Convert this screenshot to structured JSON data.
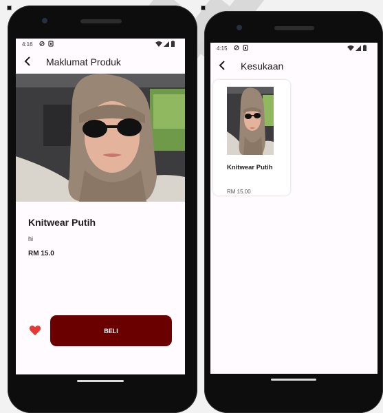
{
  "left_phone": {
    "status": {
      "time": "4:16"
    },
    "appbar": {
      "title": "Maklumat Produk",
      "back_icon": "arrow-back-icon"
    },
    "product": {
      "name": "Knitwear Putih",
      "description": "hi",
      "price": "RM 15.0"
    },
    "actions": {
      "favorite_icon": "heart-icon",
      "favorite_color": "#e53935",
      "buy_label": "BELI",
      "buy_color": "#6b0000"
    }
  },
  "right_phone": {
    "status": {
      "time": "4:15"
    },
    "appbar": {
      "title": "Kesukaan",
      "back_icon": "arrow-back-icon"
    },
    "favorites": [
      {
        "name": "Knitwear Putih",
        "price": "RM 15.00"
      }
    ]
  }
}
